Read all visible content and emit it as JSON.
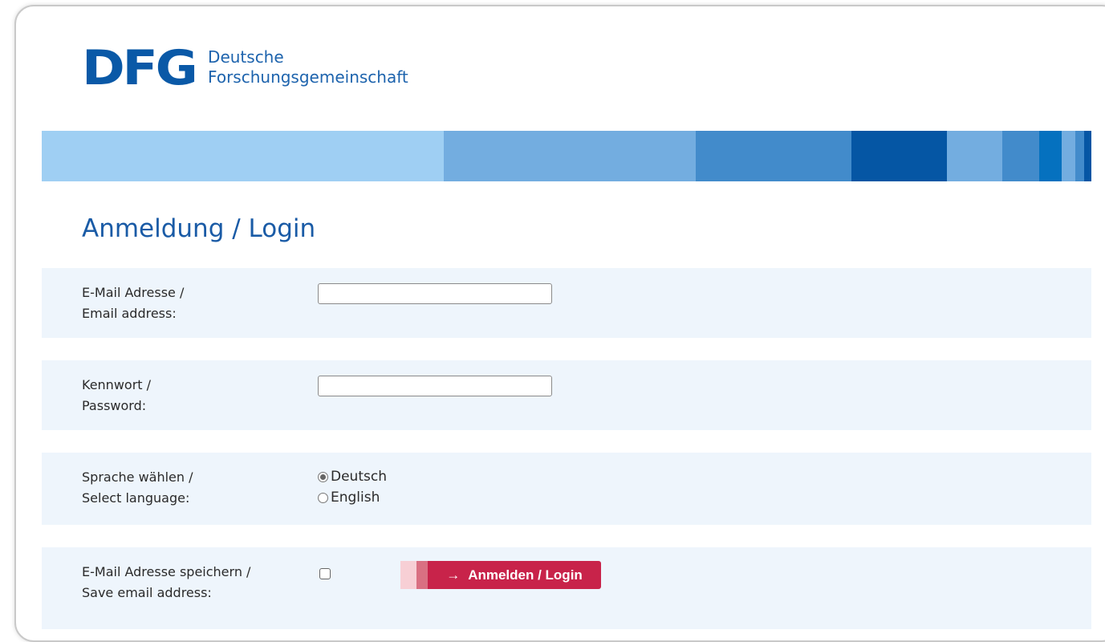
{
  "logo": {
    "mark": "DFG",
    "line1": "Deutsche",
    "line2": "Forschungsgemeinschaft"
  },
  "colors": {
    "brand_blue": "#0a59a7",
    "title_blue": "#1a5ba6",
    "row_bg": "#eef5fc",
    "button_red": "#c8234a",
    "band": [
      "#9fcff3",
      "#73ade0",
      "#428bcb",
      "#0556a4",
      "#73ade0",
      "#428bcb",
      "#0571bf",
      "#73ade0",
      "#428bcb",
      "#0556a4"
    ]
  },
  "page": {
    "title": "Anmeldung / Login"
  },
  "form": {
    "email": {
      "label_de": "E-Mail Adresse /",
      "label_en": "Email address:",
      "value": "",
      "placeholder": ""
    },
    "password": {
      "label_de": "Kennwort /",
      "label_en": "Password:",
      "value": "",
      "placeholder": ""
    },
    "language": {
      "label_de": "Sprache wählen /",
      "label_en": "Select language:",
      "options": [
        "Deutsch",
        "English"
      ],
      "selected": "Deutsch"
    },
    "save_email": {
      "label_de": "E-Mail Adresse speichern /",
      "label_en": "Save email address:",
      "checked": false
    },
    "submit": {
      "arrow": "→",
      "label": "Anmelden / Login",
      "icon": "arrow-right-icon"
    }
  }
}
